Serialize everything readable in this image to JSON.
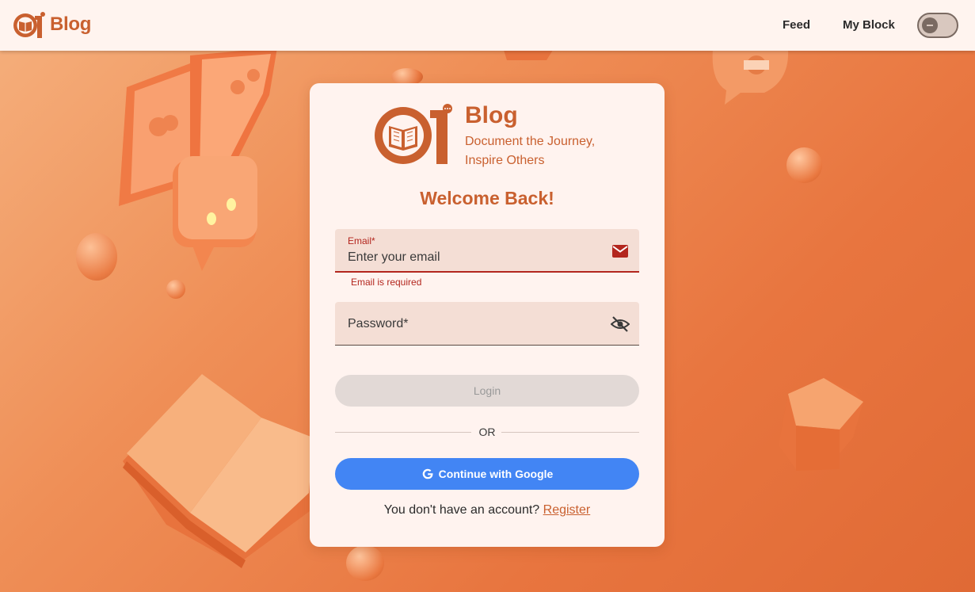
{
  "header": {
    "brand": "Blog",
    "nav": [
      "Feed",
      "My Block"
    ],
    "theme_toggle": "off"
  },
  "card": {
    "brand_title": "Blog",
    "tagline": "Document the Journey, Inspire Others",
    "welcome": "Welcome Back!",
    "email": {
      "label": "Email*",
      "placeholder": "Enter your email",
      "value": "",
      "error": "Email is required"
    },
    "password": {
      "label": "Password*",
      "value": ""
    },
    "login_label": "Login",
    "or_label": "OR",
    "google_label": "Continue with Google",
    "register_prompt": "You don't have an account?",
    "register_link": "Register"
  },
  "colors": {
    "brand": "#c9602f",
    "background": "#ec8550",
    "card": "#fff3ef",
    "field": "#f4ded5",
    "error": "#b3261e",
    "google": "#4285f4"
  },
  "icons": [
    "logo-icon",
    "mail-icon",
    "eye-off-icon",
    "google-icon",
    "theme-toggle"
  ]
}
